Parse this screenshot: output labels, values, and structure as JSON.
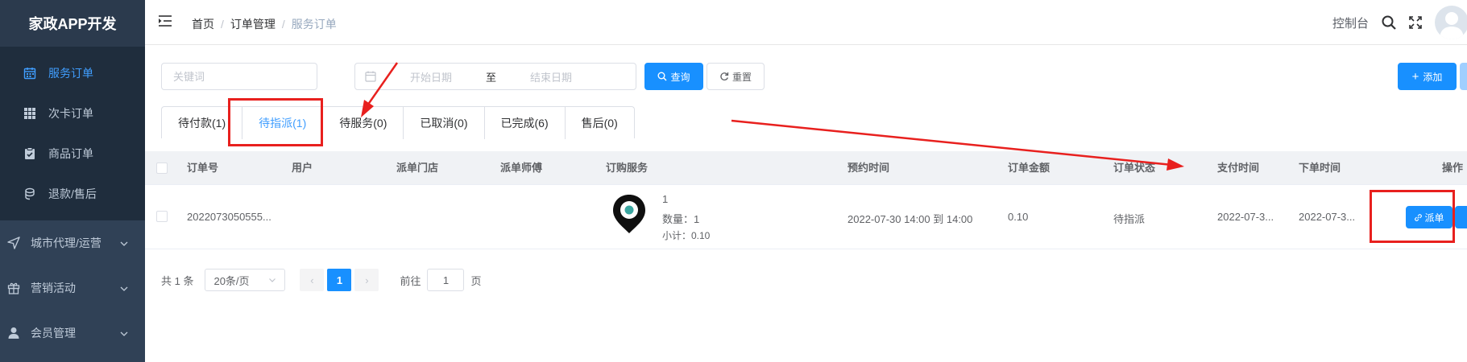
{
  "app": {
    "title": "家政APP开发"
  },
  "sidebar": {
    "sub_items": [
      {
        "label": "服务订单",
        "icon": "calendar-icon",
        "active": true
      },
      {
        "label": "次卡订单",
        "icon": "grid-icon",
        "active": false
      },
      {
        "label": "商品订单",
        "icon": "clipboard-icon",
        "active": false
      },
      {
        "label": "退款/售后",
        "icon": "refund-icon",
        "active": false
      }
    ],
    "top_items": [
      {
        "label": "城市代理/运营",
        "icon": "send-icon"
      },
      {
        "label": "营销活动",
        "icon": "gift-icon"
      },
      {
        "label": "会员管理",
        "icon": "user-icon"
      }
    ]
  },
  "navbar": {
    "breadcrumb": [
      "首页",
      "订单管理",
      "服务订单"
    ],
    "console_label": "控制台"
  },
  "filters": {
    "keyword_placeholder": "关键词",
    "start_date_placeholder": "开始日期",
    "range_separator": "至",
    "end_date_placeholder": "结束日期",
    "search_label": "查询",
    "reset_label": "重置",
    "add_label": "添加"
  },
  "tabs": [
    {
      "label": "待付款(1)",
      "active": false
    },
    {
      "label": "待指派(1)",
      "active": true
    },
    {
      "label": "待服务(0)",
      "active": false
    },
    {
      "label": "已取消(0)",
      "active": false
    },
    {
      "label": "已完成(6)",
      "active": false
    },
    {
      "label": "售后(0)",
      "active": false
    }
  ],
  "table": {
    "headers": {
      "order_no": "订单号",
      "user": "用户",
      "store": "派单门店",
      "master": "派单师傅",
      "service": "订购服务",
      "appointment": "预约时间",
      "amount": "订单金额",
      "status": "订单状态",
      "pay_time": "支付时间",
      "order_time": "下单时间",
      "action": "操作"
    },
    "rows": [
      {
        "order_no": "2022073050555...",
        "user": "",
        "store": "",
        "master": "",
        "service_name": "1",
        "quantity": "数量：1",
        "subtotal": "小计：0.10",
        "appointment": "2022-07-30 14:00 到 14:00",
        "amount": "0.10",
        "status": "待指派",
        "pay_time": "2022-07-3...",
        "order_time": "2022-07-3...",
        "dispatch_label": "派单"
      }
    ]
  },
  "pagination": {
    "total": "共 1 条",
    "page_size": "20条/页",
    "current_page": "1",
    "goto_prefix": "前往",
    "goto_value": "1",
    "goto_suffix": "页"
  },
  "colors": {
    "primary": "#1890ff",
    "sidebar": "#304156",
    "annotation": "#e8201e"
  }
}
